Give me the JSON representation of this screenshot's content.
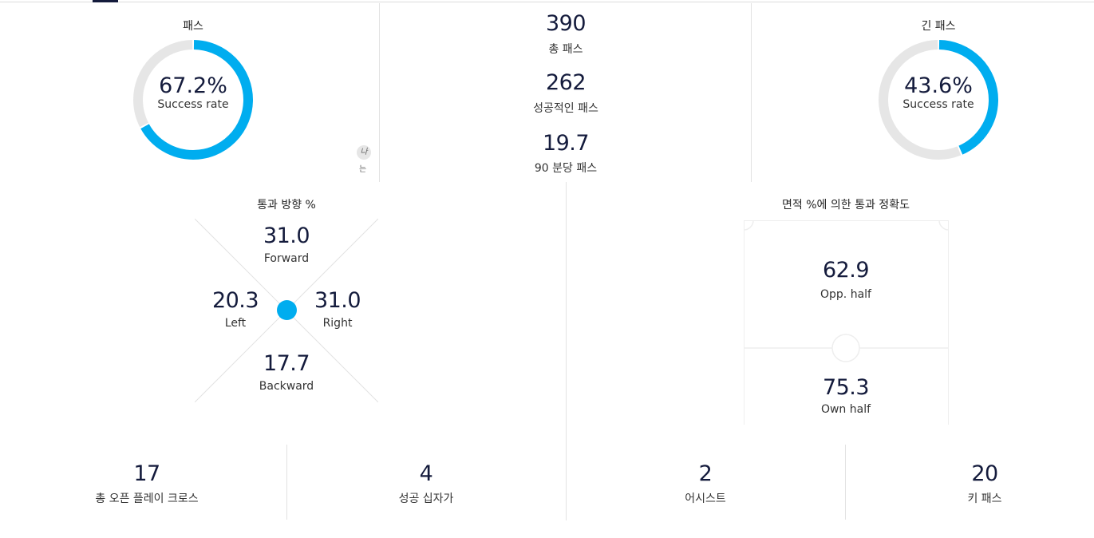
{
  "colors": {
    "accent": "#00adef",
    "track": "#e6e6e6",
    "text": "#141b3c"
  },
  "passes": {
    "title": "패스",
    "value": "67.2%",
    "fraction": 0.672,
    "label": "Success rate"
  },
  "badge": {
    "top": "나",
    "bottom": "는"
  },
  "totals": [
    {
      "value": "390",
      "label": "총 패스"
    },
    {
      "value": "262",
      "label": "성공적인 패스"
    },
    {
      "value": "19.7",
      "label": "90 분당 패스"
    }
  ],
  "long_passes": {
    "title": "긴 패스",
    "value": "43.6%",
    "fraction": 0.436,
    "label": "Success rate"
  },
  "direction": {
    "title": "통과 방향 %",
    "forward": {
      "value": "31.0",
      "label": "Forward"
    },
    "left": {
      "value": "20.3",
      "label": "Left"
    },
    "right": {
      "value": "31.0",
      "label": "Right"
    },
    "backward": {
      "value": "17.7",
      "label": "Backward"
    }
  },
  "area": {
    "title": "면적 %에 의한 통과 정확도",
    "opp": {
      "value": "62.9",
      "label": "Opp. half"
    },
    "own": {
      "value": "75.3",
      "label": "Own half"
    }
  },
  "bottom": [
    {
      "value": "17",
      "label": "총 오픈 플레이 크로스"
    },
    {
      "value": "4",
      "label": "성공 십자가"
    },
    {
      "value": "2",
      "label": "어시스트"
    },
    {
      "value": "20",
      "label": "키 패스"
    }
  ]
}
